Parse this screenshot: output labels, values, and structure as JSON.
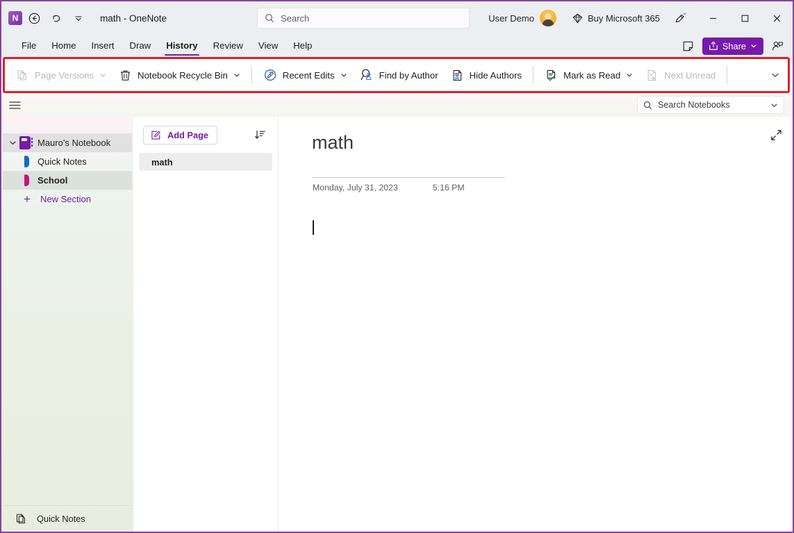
{
  "window": {
    "title": "math  -  OneNote",
    "app_logo_letter": "N",
    "border_color": "#8a3fa0"
  },
  "titlebar": {
    "back_icon": "back-arrow-icon",
    "undo_icon": "undo-icon",
    "customize_icon": "customize-quick-access-icon",
    "search": {
      "placeholder": "Search",
      "icon": "search-icon"
    },
    "user": {
      "name": "User Demo",
      "avatar_icon": "user-avatar"
    },
    "buy": {
      "label": "Buy Microsoft 365",
      "icon": "diamond-icon"
    },
    "ink_icon": "pen-ink-icon",
    "minimize": "minimize-icon",
    "maximize": "maximize-icon",
    "close": "close-icon"
  },
  "menubar": {
    "items": [
      {
        "label": "File",
        "active": false
      },
      {
        "label": "Home",
        "active": false
      },
      {
        "label": "Insert",
        "active": false
      },
      {
        "label": "Draw",
        "active": false
      },
      {
        "label": "History",
        "active": true
      },
      {
        "label": "Review",
        "active": false
      },
      {
        "label": "View",
        "active": false
      },
      {
        "label": "Help",
        "active": false
      }
    ],
    "active_underline_color": "#7719aa",
    "notes_icon": "sticky-note-icon",
    "share": {
      "label": "Share",
      "icon": "share-icon",
      "color": "#7719aa"
    },
    "comments_icon": "comments-person-icon"
  },
  "ribbon": {
    "highlight_color": "#e31e24",
    "groups": [
      {
        "items": [
          {
            "label": "Page Versions",
            "icon": "page-versions-icon",
            "dropdown": true,
            "disabled": true
          },
          {
            "label": "Notebook Recycle Bin",
            "icon": "trash-bin-icon",
            "dropdown": true,
            "disabled": false
          }
        ]
      },
      {
        "items": [
          {
            "label": "Recent Edits",
            "icon": "recent-edits-clock-pencil-icon",
            "dropdown": true,
            "disabled": false
          },
          {
            "label": "Find by Author",
            "icon": "find-by-author-icon",
            "dropdown": false,
            "disabled": false
          },
          {
            "label": "Hide Authors",
            "icon": "hide-authors-icon",
            "dropdown": false,
            "disabled": false
          }
        ]
      },
      {
        "items": [
          {
            "label": "Mark as Read",
            "icon": "mark-as-read-icon",
            "dropdown": true,
            "disabled": false
          },
          {
            "label": "Next Unread",
            "icon": "next-unread-icon",
            "dropdown": false,
            "disabled": true
          }
        ]
      }
    ],
    "expand_icon": "chevron-down-icon"
  },
  "workspace": {
    "hamburger_icon": "hamburger-menu-icon",
    "search_notebooks": {
      "placeholder": "Search Notebooks",
      "icon": "search-icon",
      "chevron": "chevron-down-icon"
    }
  },
  "navpane": {
    "notebook": {
      "label": "Mauro's Notebook",
      "icon": "notebook-icon",
      "chevron": "chevron-expanded-icon",
      "selected": true
    },
    "sections": [
      {
        "label": "Quick Notes",
        "color": "#0f6cbd",
        "selected": false,
        "bold": false
      },
      {
        "label": "School",
        "color": "#c4157a",
        "selected": true,
        "bold": true
      }
    ],
    "new_section": {
      "label": "New Section",
      "icon": "plus-icon"
    },
    "footer": {
      "label": "Quick Notes",
      "icon": "pages-icon"
    }
  },
  "pagelist": {
    "add_page": {
      "label": "Add Page",
      "icon": "add-page-pencil-icon"
    },
    "sort_icon": "sort-pages-icon",
    "pages": [
      {
        "title": "math",
        "selected": true
      }
    ]
  },
  "editor": {
    "expand_icon": "expand-diagonal-icon",
    "page_title": "math",
    "date": "Monday, July 31, 2023",
    "time": "5:16 PM",
    "body_text": ""
  }
}
